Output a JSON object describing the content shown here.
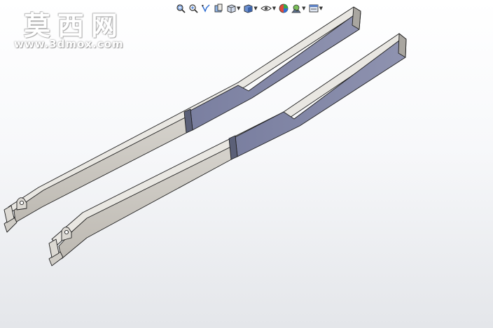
{
  "watermark": {
    "brand_cn": "莫西网",
    "url": "www.3dmox.com"
  },
  "toolbar": {
    "buttons": [
      {
        "icon": "zoom-to-fit-icon",
        "has_dropdown": false
      },
      {
        "icon": "zoom-to-area-icon",
        "has_dropdown": false
      },
      {
        "icon": "previous-view-icon",
        "has_dropdown": false
      },
      {
        "icon": "section-view-icon",
        "has_dropdown": false
      },
      {
        "icon": "view-orientation-icon",
        "has_dropdown": true
      },
      {
        "icon": "display-style-icon",
        "has_dropdown": true
      },
      {
        "icon": "hide-show-items-icon",
        "has_dropdown": true
      },
      {
        "icon": "edit-appearance-icon",
        "has_dropdown": false
      },
      {
        "icon": "apply-scene-icon",
        "has_dropdown": true
      },
      {
        "icon": "view-settings-icon",
        "has_dropdown": true
      }
    ]
  },
  "colors": {
    "beam_top": "#e8e6e1",
    "beam_side": "#c9c6bf",
    "beam_end": "#7a7f9e",
    "edge": "#1f1f1f",
    "background_top": "#ffffff",
    "background_bottom": "#e4e6ea"
  },
  "model": {
    "parts": [
      "beam-rear",
      "beam-front"
    ]
  }
}
